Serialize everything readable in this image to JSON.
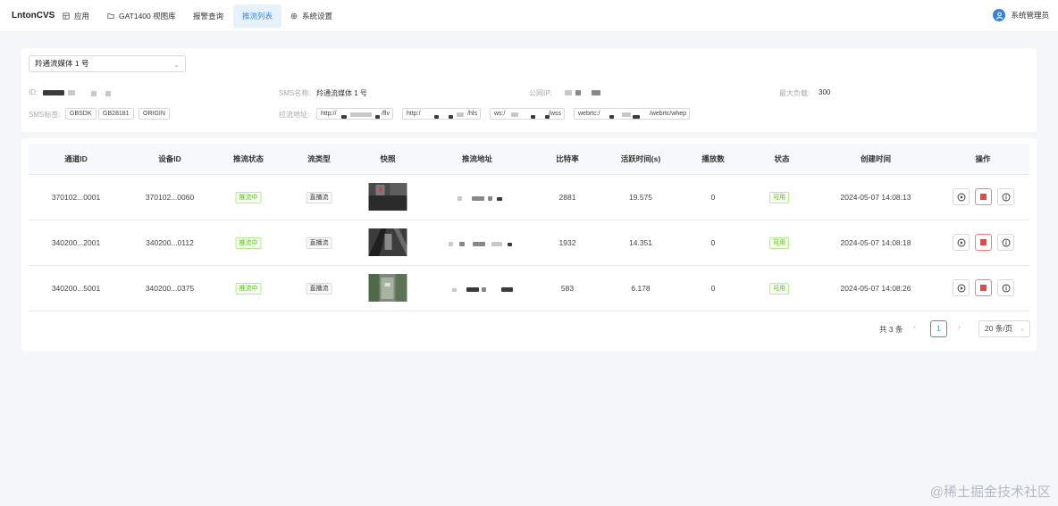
{
  "app": {
    "brand": "LntonCVS"
  },
  "nav": {
    "items": [
      {
        "label": "应用",
        "icon": "grid-icon"
      },
      {
        "label": "GAT1400 视图库",
        "icon": "folder-icon"
      },
      {
        "label": "报警查询",
        "icon": ""
      },
      {
        "label": "推流列表",
        "icon": "",
        "active": true
      },
      {
        "label": "系统设置",
        "icon": "gear-icon"
      }
    ]
  },
  "user": {
    "name": "系统管理员",
    "icon": "user-avatar-icon"
  },
  "info": {
    "media_select": "羚通流媒体 1 号",
    "id_label": "ID:",
    "sms_name_label": "SMS名称:",
    "sms_name_value": "羚通流媒体 1 号",
    "public_ip_label": "公网IP:",
    "max_load_label": "最大负载:",
    "max_load_value": "300",
    "sms_tags_label": "SMS标签:",
    "tags": [
      "GBSDK",
      "GB28181",
      "ORIGIN"
    ],
    "pull_addr_label": "拉流地址:",
    "addresses": [
      {
        "prefix": "http://",
        "suffix": "/flv"
      },
      {
        "prefix": "http:/",
        "suffix": "/hls"
      },
      {
        "prefix": "ws:/",
        "suffix": "/wss"
      },
      {
        "prefix": "webrtc:/",
        "suffix": "/webrtc/whep"
      }
    ]
  },
  "table": {
    "headers": [
      "通道ID",
      "设备ID",
      "推流状态",
      "流类型",
      "快照",
      "推流地址",
      "比特率",
      "活跃时间(s)",
      "播放数",
      "状态",
      "创建时间",
      "操作"
    ],
    "rows": [
      {
        "channel_id": "370102...0001",
        "device_id": "370102...0060",
        "push_status": "推流中",
        "stream_type": "直播流",
        "bitrate": "2881",
        "active_time": "19.575",
        "plays": "0",
        "status": "可用",
        "created": "2024-05-07 14:08:13"
      },
      {
        "channel_id": "340200...2001",
        "device_id": "340200...0112",
        "push_status": "推流中",
        "stream_type": "直播流",
        "bitrate": "1932",
        "active_time": "14.351",
        "plays": "0",
        "status": "可用",
        "created": "2024-05-07 14:08:18"
      },
      {
        "channel_id": "340200...5001",
        "device_id": "340200...0375",
        "push_status": "推流中",
        "stream_type": "直播流",
        "bitrate": "583",
        "active_time": "6.178",
        "plays": "0",
        "status": "可用",
        "created": "2024-05-07 14:08:26"
      }
    ],
    "actions": [
      "play-icon",
      "stop-icon",
      "info-icon"
    ]
  },
  "pagination": {
    "total": "共 3 条",
    "page": "1",
    "page_size": "20 条/页"
  },
  "watermark": "@稀土掘金技术社区",
  "colors": {
    "accent": "#3a8ee6",
    "success": "#52c41a",
    "danger": "#e84545",
    "page_active": "#3aa77a"
  }
}
